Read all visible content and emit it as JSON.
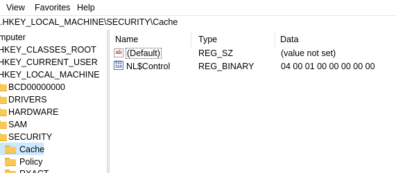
{
  "menu": [
    "View",
    "Favorites",
    "Help"
  ],
  "address": ".HKEY_LOCAL_MACHINE\\SECURITY\\Cache",
  "tree": {
    "root": "mputer",
    "hives": [
      "HKEY_CLASSES_ROOT",
      "HKEY_CURRENT_USER",
      "HKEY_LOCAL_MACHINE"
    ],
    "hklm_children": [
      "BCD00000000",
      "DRIVERS",
      "HARDWARE",
      "SAM",
      "SECURITY"
    ],
    "security_children": [
      "Cache",
      "Policy",
      "RXACT"
    ],
    "selected": "Cache"
  },
  "list": {
    "columns": [
      "Name",
      "Type",
      "Data"
    ],
    "rows": [
      {
        "name": "(Default)",
        "type": "REG_SZ",
        "data": "(value not set)",
        "icon": "string-value-icon"
      },
      {
        "name": "NL$Control",
        "type": "REG_BINARY",
        "data": "04 00 01 00 00 00 00 00",
        "icon": "binary-value-icon"
      }
    ]
  },
  "colors": {
    "selection": "#cce8ff",
    "folder": "#f8ca55"
  }
}
